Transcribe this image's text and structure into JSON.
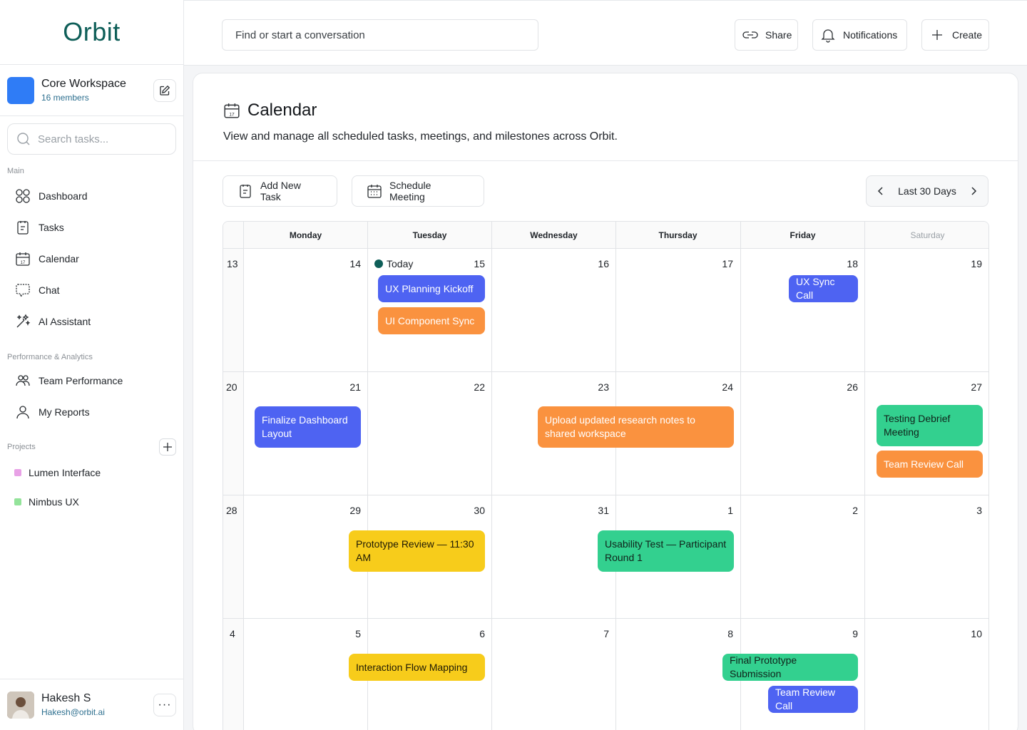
{
  "brand": {
    "logo": "Orbit"
  },
  "workspace": {
    "name": "Core Workspace",
    "members": "16 members"
  },
  "sidebar": {
    "search_placeholder": "Search tasks...",
    "main_label": "Main",
    "main_items": [
      {
        "label": "Dashboard",
        "icon": "dashboard-icon"
      },
      {
        "label": "Tasks",
        "icon": "tasks-icon"
      },
      {
        "label": "Calendar",
        "icon": "calendar-icon"
      },
      {
        "label": "Chat",
        "icon": "chat-icon"
      },
      {
        "label": "AI Assistant",
        "icon": "sparkle-icon"
      }
    ],
    "perf_label": "Performance & Analytics",
    "perf_items": [
      {
        "label": "Team Performance",
        "icon": "team-icon"
      },
      {
        "label": "My Reports",
        "icon": "user-icon"
      }
    ],
    "projects_label": "Projects",
    "projects": [
      {
        "label": "Lumen Interface",
        "color": "#e8a1e6"
      },
      {
        "label": "Nimbus UX",
        "color": "#93e39a"
      }
    ]
  },
  "user": {
    "name": "Hakesh S",
    "email": "Hakesh@orbit.ai",
    "more": "···"
  },
  "topbar": {
    "search_placeholder": "Find or start a conversation",
    "share": "Share",
    "notifications": "Notifications",
    "create": "Create"
  },
  "page": {
    "title": "Calendar",
    "subtitle": "View and manage all scheduled tasks, meetings, and milestones across Orbit.",
    "add_task": "Add New Task",
    "schedule_meeting": "Schedule Meeting",
    "range_label": "Last 30 Days"
  },
  "calendar": {
    "days": [
      "Monday",
      "Tuesday",
      "Wednesday",
      "Thursday",
      "Friday",
      "Saturday"
    ],
    "today_label": "Today",
    "weeks": [
      {
        "week": "13",
        "dates": [
          "14",
          "15",
          "16",
          "17",
          "18",
          "19"
        ]
      },
      {
        "week": "20",
        "dates": [
          "21",
          "22",
          "23",
          "24",
          "26",
          "27"
        ]
      },
      {
        "week": "28",
        "dates": [
          "29",
          "30",
          "31",
          "1",
          "2",
          "3"
        ]
      },
      {
        "week": "4",
        "dates": [
          "5",
          "6",
          "7",
          "8",
          "9",
          "10"
        ]
      }
    ],
    "events": [
      "UX Planning Kickoff",
      "UI Component Sync",
      "UX Sync Call",
      "Finalize Dashboard Layout",
      "Upload updated research notes to shared workspace",
      "Testing Debrief Meeting",
      "Team Review Call",
      "Prototype Review — 11:30 AM",
      "Usability Test — Participant Round 1",
      "Interaction Flow Mapping",
      "Final Prototype Submission",
      "Team Review Call"
    ],
    "colors": {
      "blue": "#4e63f2",
      "orange": "#fa923f",
      "green": "#33d08f",
      "yellow": "#f7cc1b",
      "today_dot": "#0e5e58"
    }
  }
}
